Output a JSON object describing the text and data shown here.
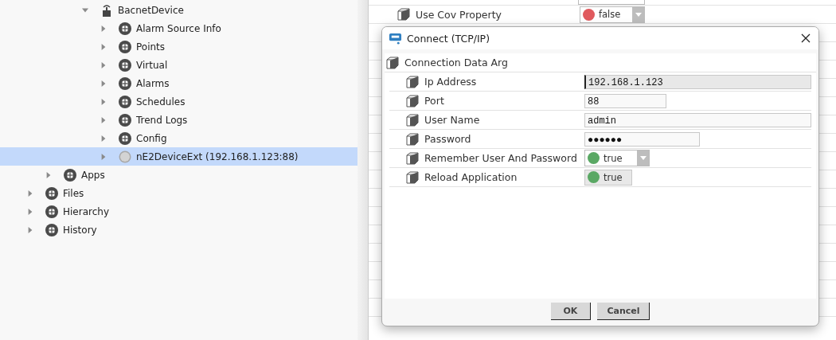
{
  "tree": [
    {
      "children": [
        {
          "children": [
            {
              "children": [
                {
                  "label": "BacnetDevice",
                  "expanded": true,
                  "selected": false,
                  "children": [
                    {
                      "label": "Alarm Source Info",
                      "expanded": false,
                      "selected": false
                    },
                    {
                      "label": "Points",
                      "expanded": false,
                      "selected": false
                    },
                    {
                      "label": "Virtual",
                      "expanded": false,
                      "selected": false
                    },
                    {
                      "label": "Alarms",
                      "expanded": false,
                      "selected": false
                    },
                    {
                      "label": "Schedules",
                      "expanded": false,
                      "selected": false
                    },
                    {
                      "label": "Trend Logs",
                      "expanded": false,
                      "selected": false
                    },
                    {
                      "label": "Config",
                      "expanded": false,
                      "selected": false
                    },
                    {
                      "label": "nE2DeviceExt (192.168.1.123:88)",
                      "expanded": false,
                      "selected": true
                    }
                  ]
                }
              ]
            }
          ]
        },
        {
          "label": "Apps",
          "expanded": false,
          "selected": false
        }
      ]
    },
    {
      "label": "Files",
      "expanded": false,
      "selected": false
    },
    {
      "label": "Hierarchy",
      "expanded": false,
      "selected": false
    },
    {
      "label": "History",
      "expanded": false,
      "selected": false
    }
  ],
  "property_sheet": {
    "rows": [
      {
        "label": "Use Cov Property",
        "value": "false",
        "color": "#e05a5e"
      }
    ]
  },
  "dialog": {
    "title": "Connect (TCP/IP)",
    "group": "Connection Data Arg",
    "fields": [
      {
        "label": "Ip Address",
        "kind": "longtext",
        "value": "192.168.1.123",
        "focused": true
      },
      {
        "label": "Port",
        "kind": "shorttext",
        "value": "88",
        "focused": false
      },
      {
        "label": "User Name",
        "kind": "longtext",
        "value": "admin",
        "focused": false
      },
      {
        "label": "Password",
        "kind": "mediumtext",
        "value": "●●●●●●",
        "focused": false
      },
      {
        "label": "Remember User And Password",
        "kind": "select",
        "value": "true",
        "color": "#5aa864"
      },
      {
        "label": "Reload Application",
        "kind": "toggle",
        "value": "true",
        "color": "#5aa864"
      }
    ],
    "buttons": [
      "OK",
      "Cancel"
    ]
  }
}
